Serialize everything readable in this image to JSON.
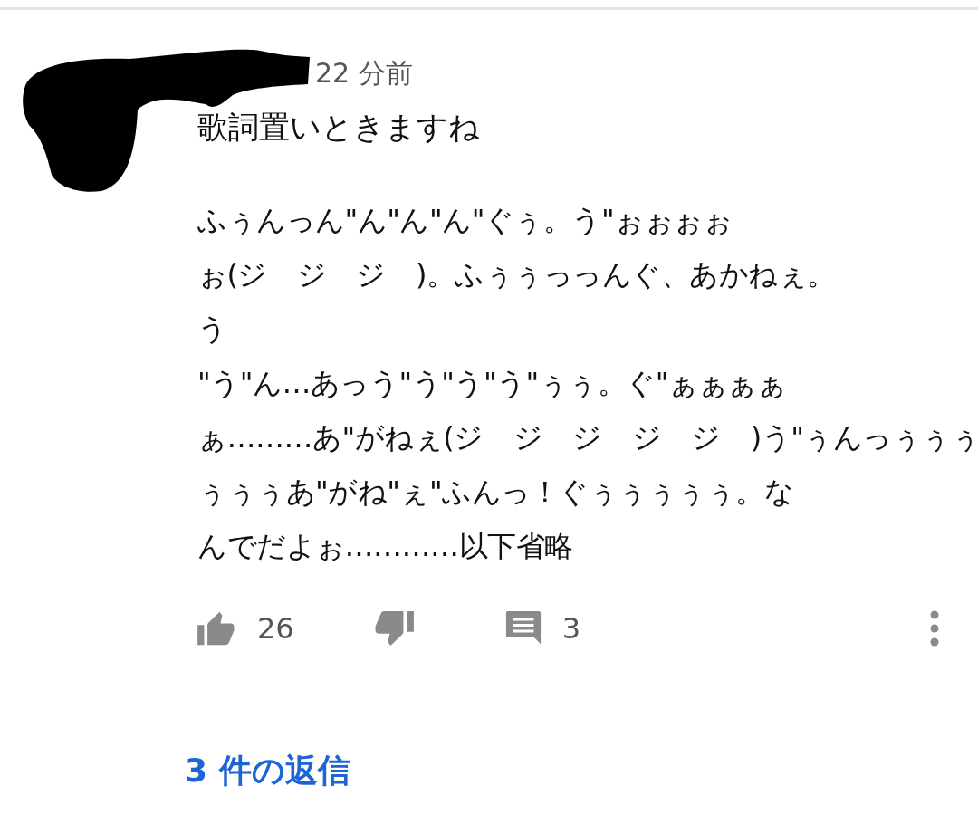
{
  "comment": {
    "time": "22 分前",
    "title": "歌詞置いときますね",
    "body_lines": [
      "ふぅんっん\"ん\"ん\"ん\"ぐぅ。う\"ぉぉぉぉ",
      "ぉ(ジ゙ジ゙ジ゙)。ふぅぅっっんぐ、あかねぇ。",
      "う",
      "\"う\"ん…あっう\"う\"う\"う\"ぅぅ。ぐ\"ぁぁぁぁ",
      "ぁ………あ\"がねぇ(ジ゙ジ゙ジ゙ジ゙ジ゙)う\"ぅんっぅぅぅ",
      "ぅぅぅあ\"がね\"ぇ\"ふんっ！ぐぅぅぅぅぅ。な",
      "んでだよぉ…………以下省略"
    ],
    "like_count": "26",
    "reply_count": "3",
    "replies_link": "3 件の返信"
  }
}
